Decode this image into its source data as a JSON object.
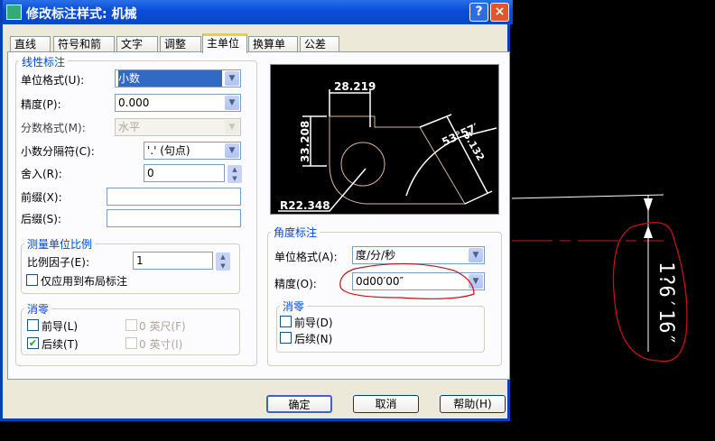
{
  "window": {
    "title": "修改标注样式: 机械",
    "help_btn": "?",
    "close_btn": "×"
  },
  "tabs": [
    "直线",
    "符号和箭头",
    "文字",
    "调整",
    "主单位",
    "换算单位",
    "公差"
  ],
  "linear": {
    "group": "线性标注",
    "unit_format_label": "单位格式(U):",
    "unit_format": "小数",
    "precision_label": "精度(P):",
    "precision": "0.000",
    "fraction_label": "分数格式(M):",
    "fraction": "水平",
    "decimal_sep_label": "小数分隔符(C):",
    "decimal_sep": "'.' (句点)",
    "round_label": "舍入(R):",
    "round": "0",
    "prefix_label": "前缀(X):",
    "prefix": "",
    "suffix_label": "后缀(S):",
    "suffix": ""
  },
  "scale": {
    "group": "测量单位比例",
    "factor_label": "比例因子(E):",
    "factor": "1",
    "layout_only": "仅应用到布局标注"
  },
  "zero_linear": {
    "group": "消零",
    "leading": "前导(L)",
    "trailing": "后续(T)",
    "feet": "0 英尺(F)",
    "inches": "0 英寸(I)"
  },
  "preview": {
    "dim1": "28.219",
    "dim2": "33.208",
    "dim3": "R22.348",
    "dim4": "53°57′",
    "dim5": "5.132"
  },
  "angular": {
    "group": "角度标注",
    "unit_format_label": "单位格式(A):",
    "unit_format": "度/分/秒",
    "precision_label": "精度(O):",
    "precision": "0d00′00″"
  },
  "zero_angular": {
    "group": "消零",
    "leading": "前导(D)",
    "trailing": "后续(N)"
  },
  "buttons": {
    "ok": "确定",
    "cancel": "取消",
    "help": "帮助(H)"
  },
  "cad": {
    "dim_text": "1?6′16″"
  }
}
